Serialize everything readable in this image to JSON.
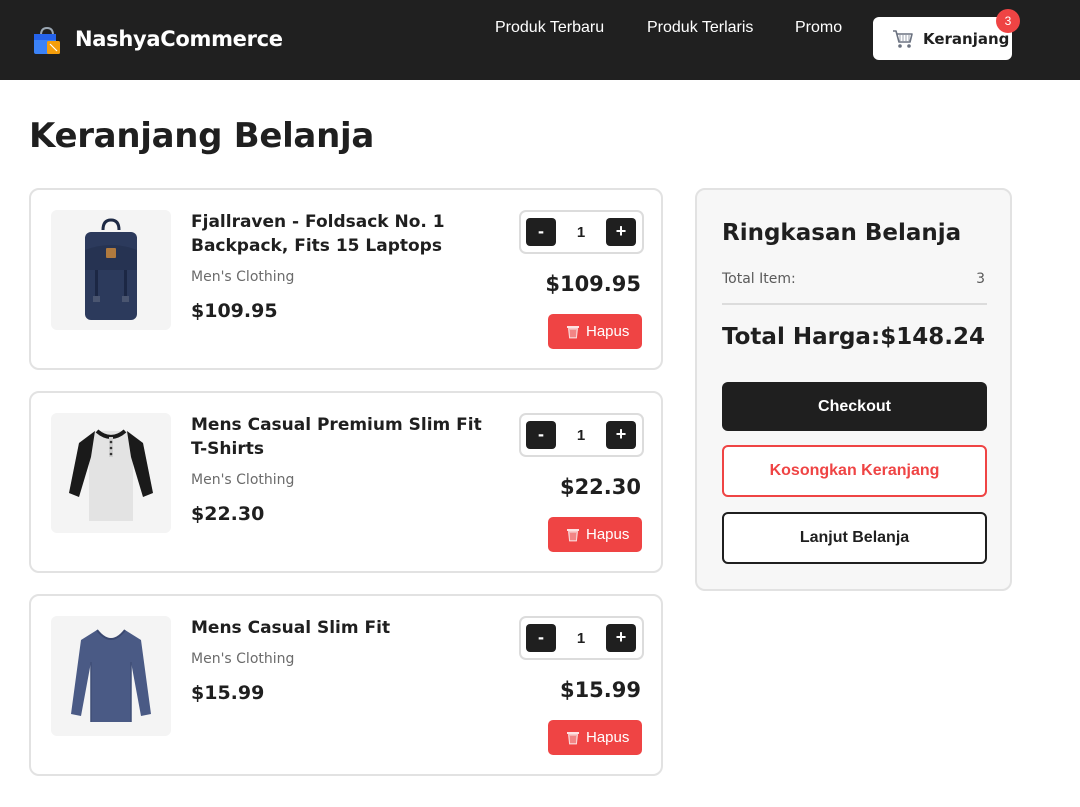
{
  "header": {
    "brand": "NashyaCommerce",
    "nav": [
      "Produk Terbaru",
      "Produk Terlaris",
      "Promo"
    ],
    "cart_label": "Keranjang",
    "cart_count": "3"
  },
  "page": {
    "title": "Keranjang Belanja"
  },
  "items": [
    {
      "name": "Fjallraven - Foldsack No. 1 Backpack, Fits 15 Laptops",
      "category": "Men's Clothing",
      "price": "$109.95",
      "quantity": "1",
      "subtotal": "$109.95",
      "remove_label": "Hapus",
      "image_icon": "backpack-icon"
    },
    {
      "name": "Mens Casual Premium Slim Fit T-Shirts",
      "category": "Men's Clothing",
      "price": "$22.30",
      "quantity": "1",
      "subtotal": "$22.30",
      "remove_label": "Hapus",
      "image_icon": "raglan-shirt-icon"
    },
    {
      "name": "Mens Casual Slim Fit",
      "category": "Men's Clothing",
      "price": "$15.99",
      "quantity": "1",
      "subtotal": "$15.99",
      "remove_label": "Hapus",
      "image_icon": "longsleeve-shirt-icon"
    }
  ],
  "qty_controls": {
    "minus": "-",
    "plus": "+"
  },
  "summary": {
    "title": "Ringkasan Belanja",
    "total_items_label": "Total Item:",
    "total_items_value": "3",
    "total_price_label": "Total Harga:",
    "total_price_value": "$148.24",
    "checkout_label": "Checkout",
    "empty_label": "Kosongkan Keranjang",
    "continue_label": "Lanjut Belanja"
  },
  "colors": {
    "header_bg": "#202020",
    "accent_red": "#ef4444",
    "primary_dark": "#1f1f1f"
  }
}
